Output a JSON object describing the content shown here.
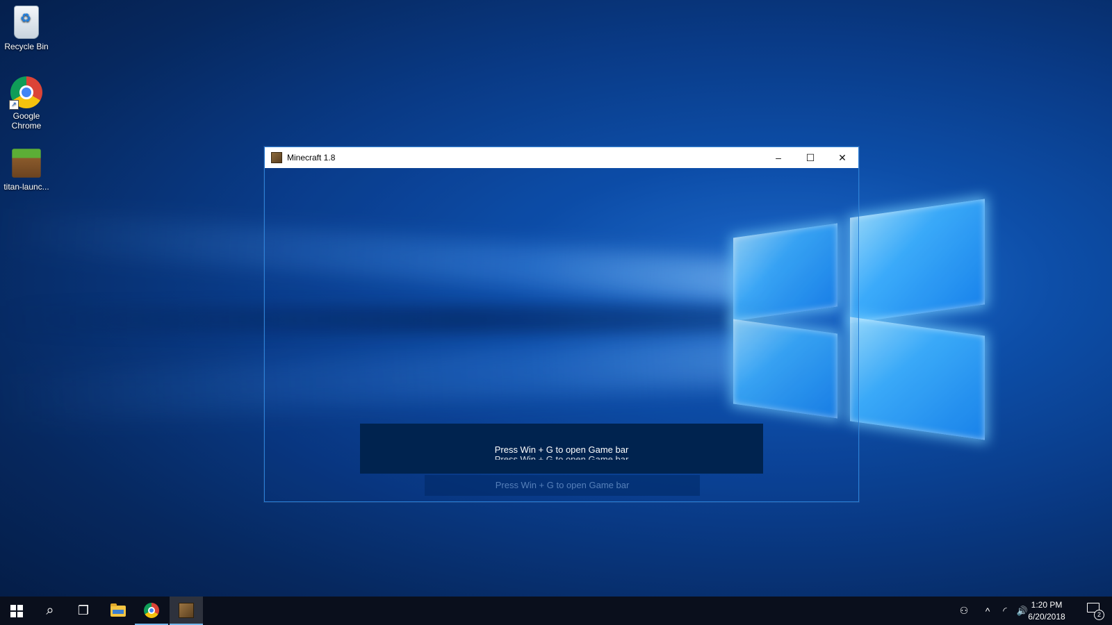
{
  "desktop": {
    "icons": [
      {
        "label": "Recycle Bin",
        "icon": "recycle-bin-icon"
      },
      {
        "label": "Google Chrome",
        "icon": "chrome-icon"
      },
      {
        "label": "titan-launc...",
        "icon": "minecraft-grass-icon"
      }
    ]
  },
  "window": {
    "title": "Minecraft 1.8",
    "controls": {
      "minimize": "–",
      "maximize": "☐",
      "close": "✕"
    },
    "toast": {
      "message": "Press Win + G to open Game bar",
      "ghost_message": "Press Win + G to open Game bar",
      "echo_message": "Press Win + G to open Game bar"
    }
  },
  "taskbar": {
    "items": [
      {
        "name": "start",
        "icon": "windows-logo-icon"
      },
      {
        "name": "search",
        "icon": "search-icon",
        "glyph": "⌕"
      },
      {
        "name": "task-view",
        "icon": "task-view-icon",
        "glyph": "❐"
      },
      {
        "name": "file-explorer",
        "icon": "folder-icon"
      },
      {
        "name": "chrome",
        "icon": "chrome-icon"
      },
      {
        "name": "minecraft",
        "icon": "minecraft-icon"
      }
    ],
    "tray": {
      "people_glyph": "⚇",
      "chevron_glyph": "^",
      "network_glyph": "◜",
      "volume_glyph": "🔊"
    },
    "clock": {
      "time": "1:20 PM",
      "date": "6/20/2018"
    },
    "notifications": {
      "count": "2"
    }
  },
  "colors": {
    "toast_bg": "#00234f",
    "taskbar_bg": "#0a0f1c",
    "active_underline": "#76b9ed"
  }
}
